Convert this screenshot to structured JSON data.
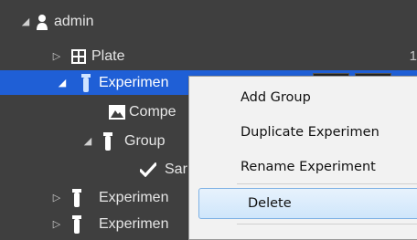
{
  "tree": {
    "root": {
      "label": "admin",
      "arrow": "◢",
      "icon": "user-icon"
    },
    "plate": {
      "label": "Plate",
      "arrow": "▷",
      "icon": "grid-icon",
      "value": "1"
    },
    "experiment_selected": {
      "label": "Experimen",
      "arrow": "◢",
      "icon": "tube-icon"
    },
    "compensation": {
      "label": "Compe",
      "icon": "image-icon"
    },
    "group": {
      "label": "Group",
      "arrow": "◢",
      "icon": "tube-icon"
    },
    "sample": {
      "label": "Sar",
      "icon": "check-icon"
    },
    "experiment_2": {
      "label": "Experimen",
      "arrow": "▷",
      "icon": "tube-icon"
    },
    "experiment_3": {
      "label": "Experimen",
      "arrow": "▷",
      "icon": "tube-icon"
    }
  },
  "context_menu": {
    "items": [
      {
        "label": "Add Group"
      },
      {
        "label": "Duplicate Experimen"
      },
      {
        "label": "Rename Experiment"
      },
      {
        "label": "Delete"
      }
    ]
  },
  "colors": {
    "background": "#3f3f3f",
    "selection": "#1f5fd6",
    "tube_icon": "#cfe3ff"
  }
}
